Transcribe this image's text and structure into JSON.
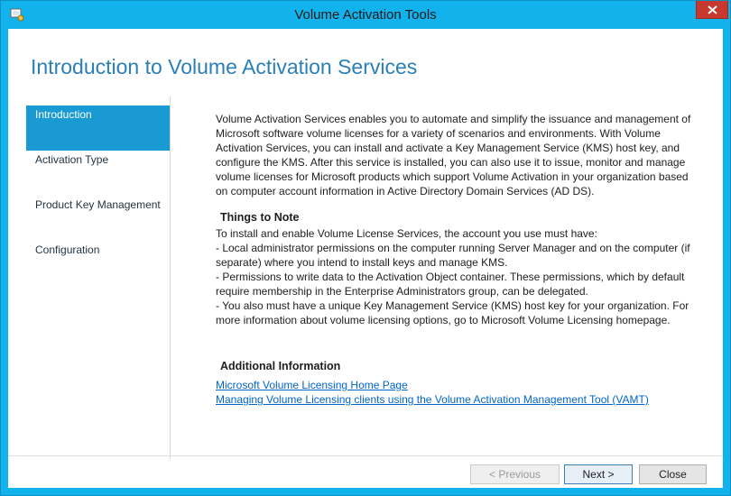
{
  "window": {
    "title": "Volume Activation Tools"
  },
  "page": {
    "title": "Introduction to Volume Activation Services"
  },
  "sidebar": {
    "items": [
      {
        "label": "Introduction"
      },
      {
        "label": "Activation Type"
      },
      {
        "label": "Product Key Management"
      },
      {
        "label": "Configuration"
      }
    ]
  },
  "content": {
    "intro": "Volume Activation Services enables you to automate and simplify the issuance and management of Microsoft software volume licenses for a variety of scenarios and environments. With Volume Activation Services, you can install and activate a Key Management Service (KMS) host key, and configure the KMS. After this service is installed, you can also use it to issue, monitor and manage volume licenses for Microsoft products which support Volume Activation in your organization based on computer account information in Active Directory Domain Services (AD DS).",
    "things_heading": "Things to Note",
    "notes": [
      "To install and enable Volume License Services, the account you use must have:",
      "- Local administrator permissions on the computer running Server Manager and on the computer (if separate) where you intend to install keys and manage KMS.",
      "- Permissions to write data to the Activation Object container. These permissions, which by default require membership in the Enterprise Administrators group, can be delegated.",
      "- You also must have a unique Key Management Service (KMS) host key for your organization. For more information about volume licensing options, go to Microsoft Volume Licensing homepage."
    ],
    "additional_heading": "Additional Information",
    "links": [
      "Microsoft Volume Licensing Home Page",
      "Managing Volume Licensing clients using the Volume Activation Management Tool (VAMT)"
    ]
  },
  "buttons": {
    "previous": "< Previous",
    "next": "Next >",
    "close": "Close"
  },
  "colors": {
    "frame": "#12b3ec",
    "accent": "#1a9ad2",
    "title_text": "#2b7fb7",
    "link": "#0066cc",
    "close_button": "#c7392f"
  }
}
